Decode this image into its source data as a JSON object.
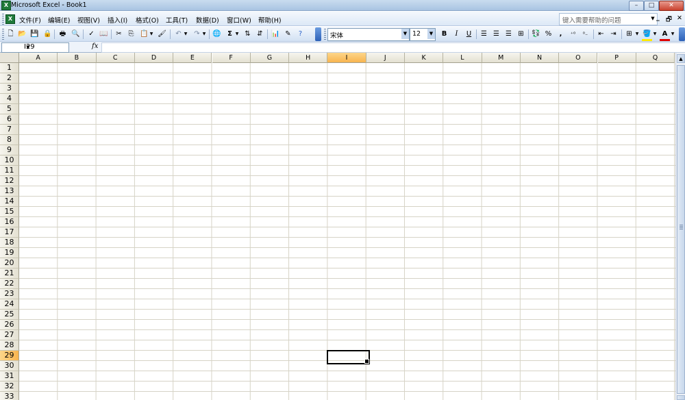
{
  "window": {
    "title": "Microsoft Excel - Book1",
    "app_icon": "excel-icon",
    "controls": [
      "minimize",
      "maximize",
      "close"
    ]
  },
  "menubar": {
    "items": [
      "文件(F)",
      "编辑(E)",
      "视图(V)",
      "插入(I)",
      "格式(O)",
      "工具(T)",
      "数据(D)",
      "窗口(W)",
      "帮助(H)"
    ],
    "help_placeholder": "键入需要帮助的问题",
    "doc_controls": [
      "minimize",
      "restore",
      "close"
    ]
  },
  "toolbar": {
    "font_name": "宋体",
    "font_size": "12",
    "bold": "B",
    "italic": "I",
    "underline": "U",
    "autosum": "Σ",
    "percent": "%",
    "comma": ",",
    "font_color_label": "A",
    "buttons": [
      "new-icon",
      "open-icon",
      "save-icon",
      "permission-icon",
      "print-icon",
      "print-preview-icon",
      "spelling-icon",
      "research-icon",
      "cut-icon",
      "copy-icon",
      "paste-icon",
      "format-painter-icon",
      "undo-icon",
      "redo-icon",
      "hyperlink-icon",
      "autosum-icon",
      "sort-ascending-icon",
      "sort-descending-icon",
      "chart-wizard-icon",
      "drawing-icon",
      "help-icon"
    ]
  },
  "formula_bar": {
    "name_box": "I29",
    "fx_label": "fx",
    "formula": ""
  },
  "sheet": {
    "columns": [
      "A",
      "B",
      "C",
      "D",
      "E",
      "F",
      "G",
      "H",
      "I",
      "J",
      "K",
      "L",
      "M",
      "N",
      "O",
      "P",
      "Q"
    ],
    "rows": [
      "1",
      "2",
      "3",
      "4",
      "5",
      "6",
      "7",
      "8",
      "9",
      "10",
      "11",
      "12",
      "13",
      "14",
      "15",
      "16",
      "17",
      "18",
      "19",
      "20",
      "21",
      "22",
      "23",
      "24",
      "25",
      "26",
      "27",
      "28",
      "29",
      "30",
      "31",
      "32",
      "33"
    ],
    "active_column": "I",
    "active_row": "29"
  }
}
